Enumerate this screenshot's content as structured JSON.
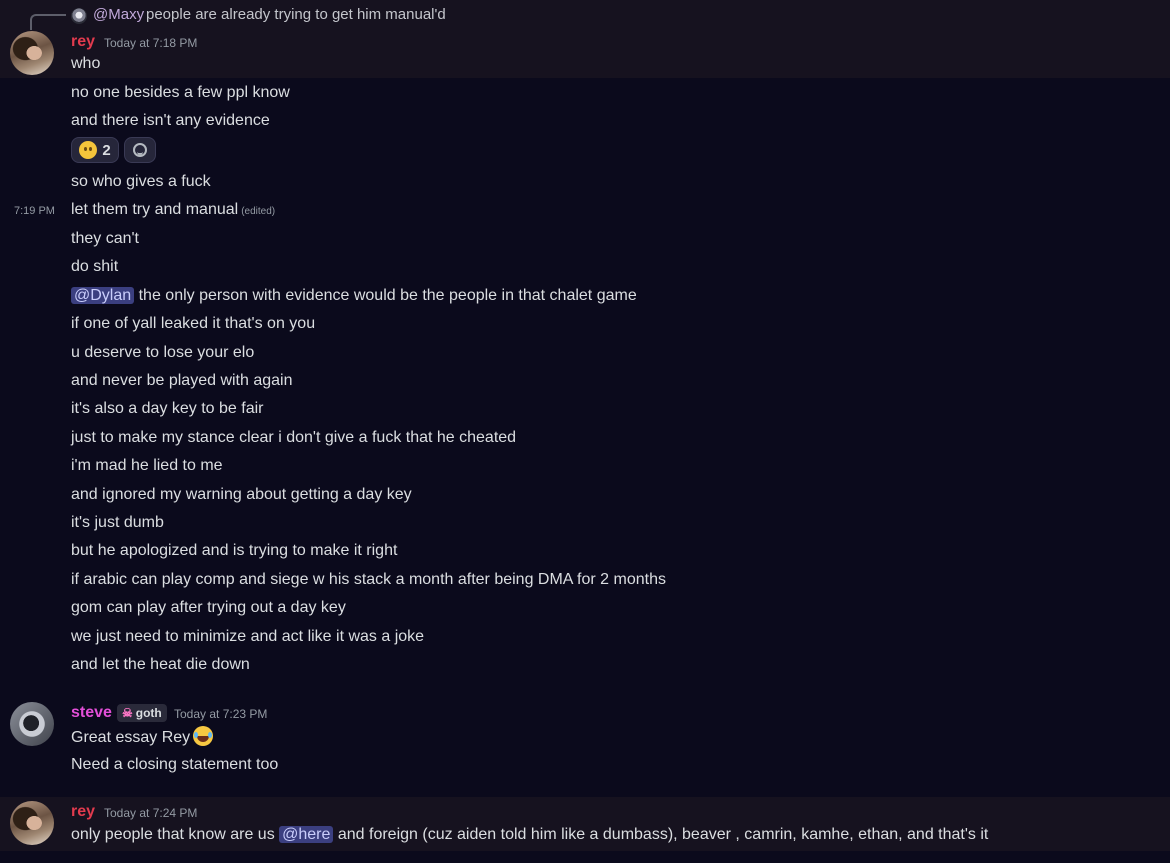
{
  "reply": {
    "author": "@Maxy",
    "text": "people are already trying to get him manual'd"
  },
  "groups": [
    {
      "author": "rey",
      "timestamp": "Today at 7:18 PM",
      "messages": [
        "who",
        "no one besides a few ppl know",
        "and there isn't any evidence"
      ],
      "reactions": [
        {
          "emoji": "neutral-face-icon",
          "count": "2"
        },
        {
          "emoji": "add-reaction-icon",
          "count": ""
        }
      ],
      "messages_after": [
        "so who gives a fuck",
        "let them try and manual",
        "they can't",
        "do shit"
      ],
      "edited_label": "(edited)",
      "side_timestamp": "7:19 PM",
      "mention_line": {
        "mention": "@Dylan",
        "text": " the only person with evidence would be the people in that chalet game"
      },
      "messages_tail": [
        "if one of yall leaked it that's on you",
        "u deserve to lose your elo",
        "and never be played with again",
        "it's also a day key to be fair",
        "just to make my stance clear i don't give a fuck that he cheated",
        "i'm mad he lied to me",
        "and ignored my warning about getting a day key",
        "it's just dumb",
        "but he apologized and is trying to make it right",
        "if arabic can play comp and siege w his stack a month after being DMA for 2 months",
        "gom can play after trying out a day key",
        "we just need to minimize and act like it was a joke",
        "and let the heat die down"
      ]
    },
    {
      "author": "steve",
      "role": "goth",
      "timestamp": "Today at 7:23 PM",
      "messages": [
        "Great essay Rey",
        "Need a closing statement too"
      ]
    },
    {
      "author": "rey",
      "timestamp": "Today at 7:24 PM",
      "message_pre": "only people that know are us ",
      "mention": "@here",
      "message_post": " and foreign (cuz aiden told him like a dumbass), beaver , camrin, kamhe, ethan, and that's it"
    }
  ],
  "colors": {
    "background": "#0b0a1c",
    "highlight_row": "#16121f",
    "rey_name": "#e23b4e",
    "steve_name": "#e34fd8",
    "mention_bg": "#3b3f80"
  }
}
